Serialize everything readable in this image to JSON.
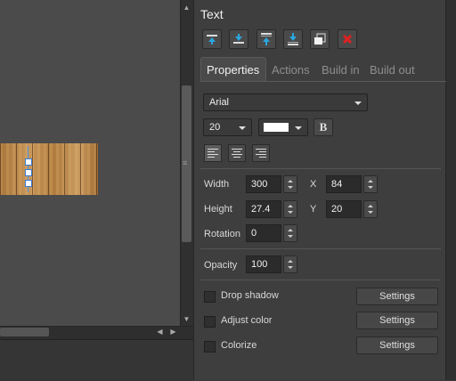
{
  "panel": {
    "title": "Text",
    "toolbar_icons": [
      "bring-forward-icon",
      "send-backward-icon",
      "bring-to-front-icon",
      "send-to-back-icon",
      "duplicate-icon",
      "delete-icon"
    ],
    "tabs": [
      "Properties",
      "Actions",
      "Build in",
      "Build out"
    ],
    "active_tab": "Properties"
  },
  "font": {
    "family": "Arial",
    "size": "20",
    "color": "#ffffff",
    "bold_label": "B"
  },
  "align": {
    "active": "left"
  },
  "geometry": {
    "width_label": "Width",
    "width_value": "300",
    "x_label": "X",
    "x_value": "84",
    "height_label": "Height",
    "height_value": "27.4",
    "y_label": "Y",
    "y_value": "20",
    "rotation_label": "Rotation",
    "rotation_value": "0"
  },
  "opacity": {
    "label": "Opacity",
    "value": "100"
  },
  "effects": [
    {
      "label": "Drop shadow",
      "button": "Settings",
      "checked": false
    },
    {
      "label": "Adjust color",
      "button": "Settings",
      "checked": false
    },
    {
      "label": "Colorize",
      "button": "Settings",
      "checked": false
    }
  ],
  "colors": {
    "accent": "#2aa7e0",
    "delete": "#e02020"
  }
}
